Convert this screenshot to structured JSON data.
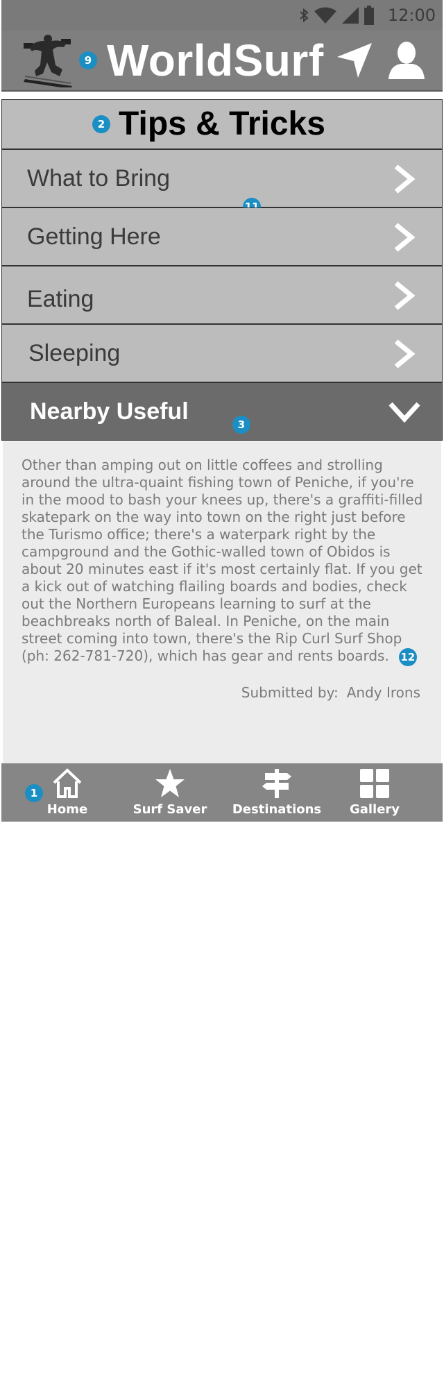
{
  "status_bar": {
    "time": "12:00",
    "icons": [
      "bluetooth-icon",
      "wifi-icon",
      "cell-signal-icon",
      "battery-icon"
    ]
  },
  "app_bar": {
    "title": "WorldSurf",
    "logo": "surfer-logo",
    "actions": [
      "navigation-arrow-icon",
      "profile-icon"
    ]
  },
  "page": {
    "title": "Tips & Tricks"
  },
  "menu": {
    "items": [
      {
        "label": "What to Bring",
        "icon": "chevron-right-icon"
      },
      {
        "label": "Getting Here",
        "icon": "chevron-right-icon"
      },
      {
        "label": "Eating",
        "icon": "chevron-right-icon"
      },
      {
        "label": "Sleeping",
        "icon": "chevron-right-icon"
      },
      {
        "label": "Nearby Useful",
        "icon": "chevron-down-icon",
        "expanded": true
      }
    ]
  },
  "tip": {
    "body": "Other than amping out on little coffees and strolling around the ultra-quaint fishing town of Peniche, if you're in the mood to bash your knees up, there's a graffiti-filled skatepark on the way into town on the right just before the Turismo office; there's a waterpark right by the campground and the Gothic-walled town of Obidos is about 20 minutes east if it's most certainly flat. If you get a kick out of watching flailing boards and bodies, check out the Northern Europeans learning to surf at the beachbreaks north of Baleal. In Peniche, on the main street coming into town, there's the Rip Curl Surf Shop (ph: 262-781-720), which has gear and rents boards.",
    "submitted_label": "Submitted by:",
    "submitted_name": "Andy Irons"
  },
  "bottom_nav": {
    "tabs": [
      {
        "label": "Home",
        "icon": "home-icon"
      },
      {
        "label": "Surf Saver",
        "icon": "star-icon"
      },
      {
        "label": "Destinations",
        "icon": "signpost-icon"
      },
      {
        "label": "Gallery",
        "icon": "grid-icon"
      }
    ]
  },
  "annotations": {
    "a1": "1",
    "a2": "2",
    "a3": "3",
    "a9": "9",
    "a11": "11",
    "a12": "12"
  },
  "colors": {
    "badge": "#1b8ec4",
    "app_bar": "#7f7f7f",
    "row": "#bcbcbc",
    "row_expanded": "#6b6b6b",
    "content_bg": "#ececec",
    "bottom_bar": "#868686"
  }
}
